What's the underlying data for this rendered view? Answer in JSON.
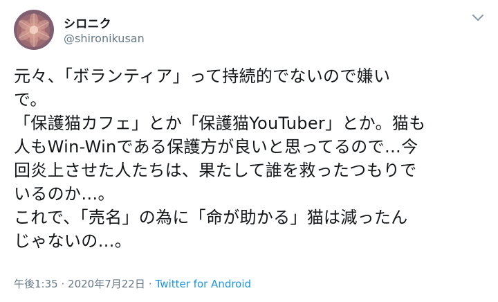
{
  "author": {
    "display_name": "シロニク",
    "handle": "@shironikusan"
  },
  "icons": {
    "avatar": "succulent-photo-avatar",
    "menu": "chevron-down-icon"
  },
  "tweet": {
    "lines": [
      "元々、「ボランティア」って持続的でないので嫌い",
      "で。",
      "「保護猫カフェ」とか「保護猫YouTuber」とか。猫も",
      "人もWin-Winである保護方が良いと思ってるので…今",
      "回炎上させた人たちは、果たして誰を救ったつもりで",
      "いるのか…。",
      "これで、「売名」の為に「命が助かる」猫は減ったん",
      "じゃないの…。"
    ]
  },
  "meta": {
    "time": "午後1:35",
    "separator": "·",
    "date": "2020年7月22日",
    "source": "Twitter for Android"
  },
  "colors": {
    "text": "#14171a",
    "muted": "#657786",
    "link": "#1b95e0"
  }
}
